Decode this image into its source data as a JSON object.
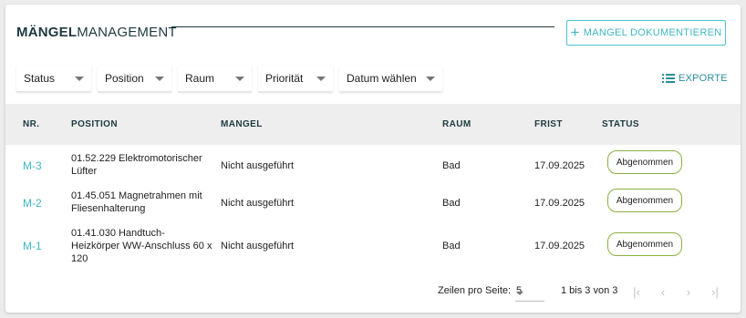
{
  "header": {
    "title_bold": "MÄNGEL",
    "title_rest": "MANAGEMENT",
    "document_button": "MANGEL DOKUMENTIEREN"
  },
  "filters": {
    "status": "Status",
    "position": "Position",
    "raum": "Raum",
    "prioritaet": "Priorität",
    "datum": "Datum wählen"
  },
  "export_label": "EXPORTE",
  "table": {
    "headers": {
      "nr": "NR.",
      "position": "POSITION",
      "mangel": "MANGEL",
      "raum": "RAUM",
      "frist": "FRIST",
      "status": "STATUS"
    },
    "rows": [
      {
        "nr": "M-3",
        "position_line1": "01.52.229 Elektromotorischer",
        "position_line2": "Lüfter",
        "position_line3": "",
        "mangel": "Nicht ausgeführt",
        "raum": "Bad",
        "frist": "17.09.2025",
        "status": "Abgenommen"
      },
      {
        "nr": "M-2",
        "position_line1": "01.45.051 Magnetrahmen mit",
        "position_line2": "Fliesenhalterung",
        "position_line3": "",
        "mangel": "Nicht ausgeführt",
        "raum": "Bad",
        "frist": "17.09.2025",
        "status": "Abgenommen"
      },
      {
        "nr": "M-1",
        "position_line1": "01.41.030 Handtuch-",
        "position_line2": "Heizkörper WW-Anschluss 60 x",
        "position_line3": "120",
        "mangel": "Nicht ausgeführt",
        "raum": "Bad",
        "frist": "17.09.2025",
        "status": "Abgenommen"
      }
    ]
  },
  "pagination": {
    "rows_per_page_label": "Zeilen pro Seite:",
    "rows_per_page": "5",
    "range": "1 bis 3 von 3"
  },
  "colors": {
    "accent": "#3eb6c4",
    "title": "#1d3a40",
    "badge_border": "#8bb043",
    "header_bg": "#eeeeee"
  },
  "icons": {
    "document_button": "plus-icon",
    "export": "list-icon",
    "first_page": "first-page-icon",
    "prev_page": "chevron-left-icon",
    "next_page": "chevron-right-icon",
    "last_page": "last-page-icon"
  }
}
